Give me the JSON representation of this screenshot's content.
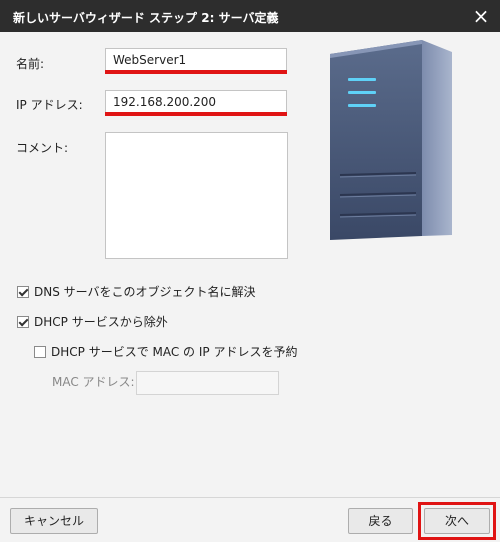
{
  "window": {
    "title": "新しいサーバウィザード ステップ 2: サーバ定義"
  },
  "form": {
    "name_label": "名前:",
    "name_value": "WebServer1",
    "ip_label": "IP アドレス:",
    "ip_value": "192.168.200.200",
    "comment_label": "コメント:",
    "comment_value": ""
  },
  "options": {
    "dns_resolve": {
      "label": "DNS サーバをこのオブジェクト名に解決",
      "checked": true
    },
    "dhcp_exclude": {
      "label": "DHCP サービスから除外",
      "checked": true
    },
    "dhcp_reserve": {
      "label": "DHCP サービスで MAC の IP アドレスを予約",
      "checked": false
    },
    "mac_label": "MAC アドレス:",
    "mac_value": ""
  },
  "buttons": {
    "cancel": "キャンセル",
    "back": "戻る",
    "next": "次へ"
  },
  "icons": {
    "close": "close-icon",
    "server": "server-icon",
    "check": "checkmark-icon"
  },
  "colors": {
    "highlight": "#e01414",
    "titlebar": "#2d2d2d"
  }
}
